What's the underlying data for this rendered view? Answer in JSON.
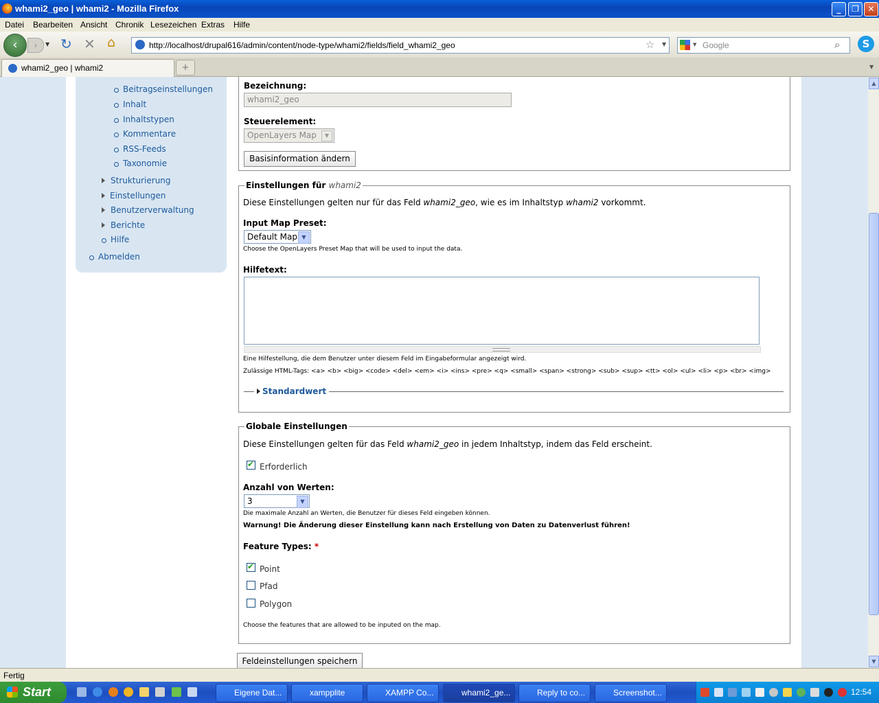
{
  "window": {
    "title": "whami2_geo | whami2 - Mozilla Firefox"
  },
  "menu": [
    "Datei",
    "Bearbeiten",
    "Ansicht",
    "Chronik",
    "Lesezeichen",
    "Extras",
    "Hilfe"
  ],
  "toolbar": {
    "url": "http://localhost/drupal616/admin/content/node-type/whami2/fields/field_whami2_geo",
    "search_placeholder": "Google"
  },
  "tab": {
    "label": "whami2_geo | whami2"
  },
  "sidebar": {
    "sub_items": [
      "Beitragseinstellungen",
      "Inhalt",
      "Inhaltstypen",
      "Kommentare",
      "RSS-Feeds",
      "Taxonomie"
    ],
    "collapsed_items": [
      "Strukturierung",
      "Einstellungen",
      "Benutzerverwaltung",
      "Berichte"
    ],
    "help": "Hilfe",
    "logout": "Abmelden"
  },
  "basic": {
    "label_title": "Bezeichnung:",
    "label_value": "whami2_geo",
    "widget_title": "Steuerelement:",
    "widget_value": "OpenLayers Map",
    "change_button": "Basisinformation ändern"
  },
  "settings": {
    "legend_prefix": "Einstellungen für ",
    "legend_type": "whami2",
    "intro_1": "Diese Einstellungen gelten nur für das Feld ",
    "intro_field": "whami2_geo",
    "intro_2": ", wie es im Inhaltstyp ",
    "intro_type": "whami2",
    "intro_3": " vorkommt.",
    "preset_label": "Input Map Preset:",
    "preset_value": "Default Map",
    "preset_desc": "Choose the OpenLayers Preset Map that will be used to input the data.",
    "help_label": "Hilfetext:",
    "help_value": "",
    "help_desc": "Eine Hilfestellung, die dem Benutzer unter diesem Feld im Eingabeformular angezeigt wird.",
    "allowed_tags": "Zulässige HTML-Tags: <a> <b> <big> <code> <del> <em> <i> <ins> <pre> <q> <small> <span> <strong> <sub> <sup> <tt> <ol> <ul> <li> <p> <br> <img>",
    "default_toggle": "Standardwert"
  },
  "global": {
    "legend": "Globale Einstellungen",
    "intro_1": "Diese Einstellungen gelten für das Feld ",
    "intro_field": "whami2_geo",
    "intro_2": " in jedem Inhaltstyp, indem das Feld erscheint.",
    "required_label": "Erforderlich",
    "required_checked": true,
    "count_label": "Anzahl von Werten:",
    "count_value": "3",
    "count_desc": "Die maximale Anzahl an Werten, die Benutzer für dieses Feld eingeben können.",
    "warning": "Warnung! Die Änderung dieser Einstellung kann nach Erstellung von Daten zu Datenverlust führen!",
    "feature_label": "Feature Types:",
    "required_marker": "*",
    "features": [
      {
        "label": "Point",
        "checked": true
      },
      {
        "label": "Pfad",
        "checked": false
      },
      {
        "label": "Polygon",
        "checked": false
      }
    ],
    "feature_desc": "Choose the features that are allowed to be inputed on the map."
  },
  "save_button": "Feldeinstellungen speichern",
  "status": "Fertig",
  "taskbar": {
    "start": "Start",
    "tasks": [
      "Eigene Dat...",
      "xampplite",
      "XAMPP Co...",
      "whami2_ge...",
      "Reply to co...",
      "Screenshot..."
    ],
    "clock": "12:54"
  },
  "colors": {
    "link": "#1e5a9c",
    "sidebar_bg": "#d9e6f2",
    "page_bg": "#dbe7f3",
    "titlebar": "#0846b8"
  }
}
